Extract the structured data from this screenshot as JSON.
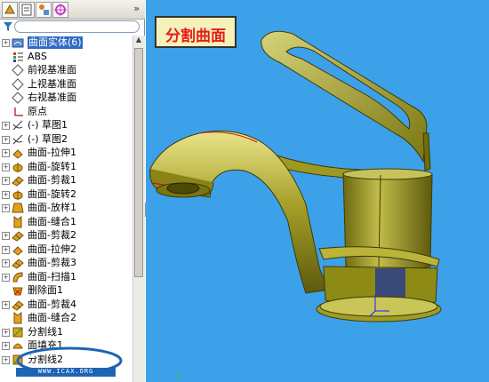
{
  "viewport_title": "分割曲面",
  "toolbar": {
    "more": "»",
    "tabs": [
      "featuremanager-tab-icon",
      "propertymanager-tab-icon",
      "configurationmanager-tab-icon",
      "dimxpert-tab-icon"
    ]
  },
  "filter": {
    "value": "",
    "placeholder": ""
  },
  "tree": {
    "items": [
      {
        "label": "曲面实体(6)",
        "icon": "surface-bodies-folder-icon",
        "expander": "+",
        "selected": true
      },
      {
        "label": "ABS",
        "icon": "material-icon",
        "expander": ""
      },
      {
        "label": "前视基准面",
        "icon": "plane-icon",
        "expander": ""
      },
      {
        "label": "上视基准面",
        "icon": "plane-icon",
        "expander": ""
      },
      {
        "label": "右视基准面",
        "icon": "plane-icon",
        "expander": ""
      },
      {
        "label": "原点",
        "icon": "origin-icon",
        "expander": ""
      },
      {
        "label": "(-) 草图1",
        "icon": "sketch-icon",
        "expander": "+"
      },
      {
        "label": "(-) 草图2",
        "icon": "sketch-icon",
        "expander": "+"
      },
      {
        "label": "曲面-拉伸1",
        "icon": "surface-extrude-icon",
        "expander": "+"
      },
      {
        "label": "曲面-旋转1",
        "icon": "surface-revolve-icon",
        "expander": "+"
      },
      {
        "label": "曲面-剪裁1",
        "icon": "surface-trim-icon",
        "expander": "+"
      },
      {
        "label": "曲面-旋转2",
        "icon": "surface-revolve-icon",
        "expander": "+"
      },
      {
        "label": "曲面-放样1",
        "icon": "surface-loft-icon",
        "expander": "+"
      },
      {
        "label": "曲面-缝合1",
        "icon": "surface-knit-icon",
        "expander": ""
      },
      {
        "label": "曲面-剪裁2",
        "icon": "surface-trim-icon",
        "expander": "+"
      },
      {
        "label": "曲面-拉伸2",
        "icon": "surface-extrude-icon",
        "expander": "+"
      },
      {
        "label": "曲面-剪裁3",
        "icon": "surface-trim-icon",
        "expander": "+"
      },
      {
        "label": "曲面-扫描1",
        "icon": "surface-sweep-icon",
        "expander": "+"
      },
      {
        "label": "删除面1",
        "icon": "delete-face-icon",
        "expander": ""
      },
      {
        "label": "曲面-剪裁4",
        "icon": "surface-trim-icon",
        "expander": "+"
      },
      {
        "label": "曲面-缝合2",
        "icon": "surface-knit-icon",
        "expander": ""
      },
      {
        "label": "分割线1",
        "icon": "split-line-icon",
        "expander": "+"
      },
      {
        "label": "面填充1",
        "icon": "fill-surface-icon",
        "expander": "+"
      },
      {
        "label": "分割线2",
        "icon": "split-line-icon",
        "expander": "+"
      }
    ]
  },
  "watermark": {
    "logo": "ICAX",
    "url": "WWW.ICAX.ORG"
  },
  "colors": {
    "viewport_bg": "#3da1ea",
    "model": "#8e8a16",
    "title_text": "#e51b1b",
    "title_bg": "#f6f0ba",
    "selection": "#316ac5"
  }
}
